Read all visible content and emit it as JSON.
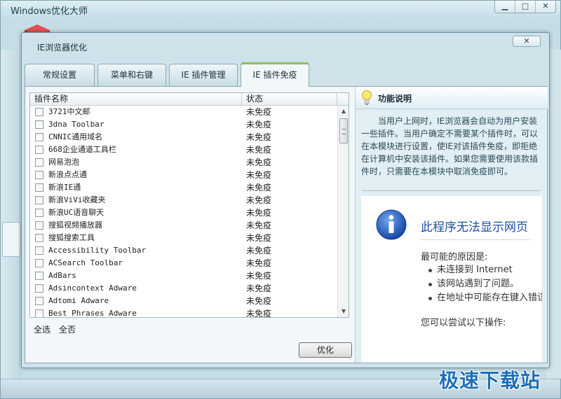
{
  "app": {
    "title": "Windows优化大师",
    "controls": {
      "minimize": "▁",
      "maximize": "□",
      "close": "✕"
    }
  },
  "dialog": {
    "title": "IE浏览器优化",
    "close": "✕"
  },
  "tabs": [
    {
      "label": "常规设置",
      "active": false
    },
    {
      "label": "菜单和右键",
      "active": false
    },
    {
      "label": "IE 插件管理",
      "active": false
    },
    {
      "label": "IE 插件免疫",
      "active": true
    }
  ],
  "plugin_list": {
    "columns": {
      "name": "插件名称",
      "status": "状态"
    },
    "rows": [
      {
        "name": "3721中文邮",
        "status": "未免疫"
      },
      {
        "name": "3dna Toolbar",
        "status": "未免疫"
      },
      {
        "name": "CNNIC通用域名",
        "status": "未免疫"
      },
      {
        "name": "668企业通道工具栏",
        "status": "未免疫"
      },
      {
        "name": "网易泡泡",
        "status": "未免疫"
      },
      {
        "name": "新浪点点通",
        "status": "未免疫"
      },
      {
        "name": "新浪IE通",
        "status": "未免疫"
      },
      {
        "name": "新浪ViVi收藏夹",
        "status": "未免疫"
      },
      {
        "name": "新浪UC语音聊天",
        "status": "未免疫"
      },
      {
        "name": "搜狐视频播放器",
        "status": "未免疫"
      },
      {
        "name": "搜狐搜索工具",
        "status": "未免疫"
      },
      {
        "name": "Accessibility Toolbar",
        "status": "未免疫"
      },
      {
        "name": "ACSearch Toolbar",
        "status": "未免疫"
      },
      {
        "name": "AdBars",
        "status": "未免疫"
      },
      {
        "name": "Adsincontext Adware",
        "status": "未免疫"
      },
      {
        "name": "Adtomi Adware",
        "status": "未免疫"
      },
      {
        "name": "Best Phrases Adware",
        "status": "未免疫"
      }
    ]
  },
  "actions": {
    "select_all": "全选",
    "deselect_all": "全否",
    "optimize": "优化"
  },
  "info": {
    "title": "功能说明",
    "description": "当用户上网时，IE浏览器会自动为用户安装一些插件。当用户确定不需要某个插件时，可以在本模块进行设置，使IE对该插件免疫，即拒绝在计算机中安装该插件。如果您需要使用该款插件时，只需要在本模块中取消免疫即可。"
  },
  "ie_error": {
    "title": "此程序无法显示网页",
    "subtitle": "最可能的原因是:",
    "reasons": [
      "未连接到 Internet",
      "该网站遇到了问题。",
      "在地址中可能存在键入错误。"
    ],
    "try": "您可以尝试以下操作:"
  },
  "watermark": "极速下载站"
}
